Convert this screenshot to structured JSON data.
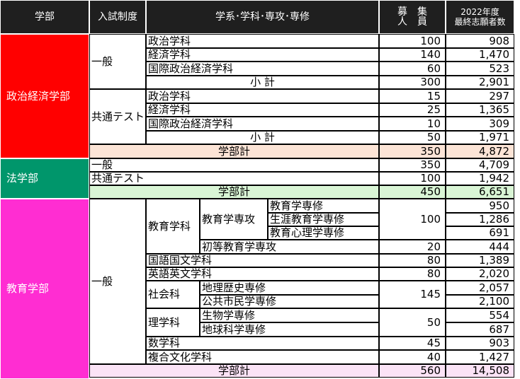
{
  "header": {
    "faculty": "学部",
    "exam_system": "入試制度",
    "dept": "学系･学科･専攻･専修",
    "capacity": "募　集\n人　員",
    "applicants_line1": "2022年度",
    "applicants_line2": "最終志願者数"
  },
  "colors": {
    "politics": "#ff0000",
    "law": "#00966b",
    "education": "#ff2dd2",
    "politics_total_bg": "#fce4d6",
    "law_total_bg": "#d9f5d5",
    "education_total_bg": "#fbe3f6",
    "header_bg": "#1f1f1f"
  },
  "politics": {
    "name": "政治経済学部",
    "ippan": {
      "label": "一般",
      "rows": [
        {
          "dept": "政治学科",
          "cap": "100",
          "app": "908"
        },
        {
          "dept": "経済学科",
          "cap": "140",
          "app": "1,470"
        },
        {
          "dept": "国際政治経済学科",
          "cap": "60",
          "app": "523"
        }
      ],
      "subtotal": {
        "label": "小 計",
        "cap": "300",
        "app": "2,901"
      }
    },
    "kyotsu": {
      "label": "共通テスト",
      "rows": [
        {
          "dept": "政治学科",
          "cap": "15",
          "app": "297"
        },
        {
          "dept": "経済学科",
          "cap": "25",
          "app": "1,365"
        },
        {
          "dept": "国際政治経済学科",
          "cap": "10",
          "app": "309"
        }
      ],
      "subtotal": {
        "label": "小 計",
        "cap": "50",
        "app": "1,971"
      }
    },
    "total": {
      "label": "学部計",
      "cap": "350",
      "app": "4,872"
    }
  },
  "law": {
    "name": "法学部",
    "rows": [
      {
        "system": "一般",
        "cap": "350",
        "app": "4,709"
      },
      {
        "system": "共通テスト",
        "cap": "100",
        "app": "1,942"
      }
    ],
    "total": {
      "label": "学部計",
      "cap": "450",
      "app": "6,651"
    }
  },
  "education": {
    "name": "教育学部",
    "system": "一般",
    "kyoiku": {
      "name": "教育学科",
      "major": "教育学専攻",
      "courses": [
        "教育学専修",
        "生涯教育学専修",
        "教育心理学専修"
      ],
      "course_cap": "100",
      "course_apps": [
        "950",
        "1,286",
        "691"
      ],
      "shoto": {
        "name": "初等教育学専攻",
        "cap": "20",
        "app": "444"
      }
    },
    "kokugo": {
      "name": "国語国文学科",
      "cap": "80",
      "app": "1,389"
    },
    "eigo": {
      "name": "英語英文学科",
      "cap": "80",
      "app": "2,020"
    },
    "shakai": {
      "name": "社会科",
      "courses": [
        "地理歴史専修",
        "公共市民学専修"
      ],
      "cap": "145",
      "apps": [
        "2,057",
        "2,100"
      ]
    },
    "rika": {
      "name": "理学科",
      "courses": [
        "生物学専修",
        "地球科学専修"
      ],
      "cap": "50",
      "apps": [
        "554",
        "687"
      ]
    },
    "sugaku": {
      "name": "数学科",
      "cap": "45",
      "app": "903"
    },
    "fukugo": {
      "name": "複合文化学科",
      "cap": "40",
      "app": "1,427"
    },
    "total": {
      "label": "学部計",
      "cap": "560",
      "app": "14,508"
    }
  }
}
